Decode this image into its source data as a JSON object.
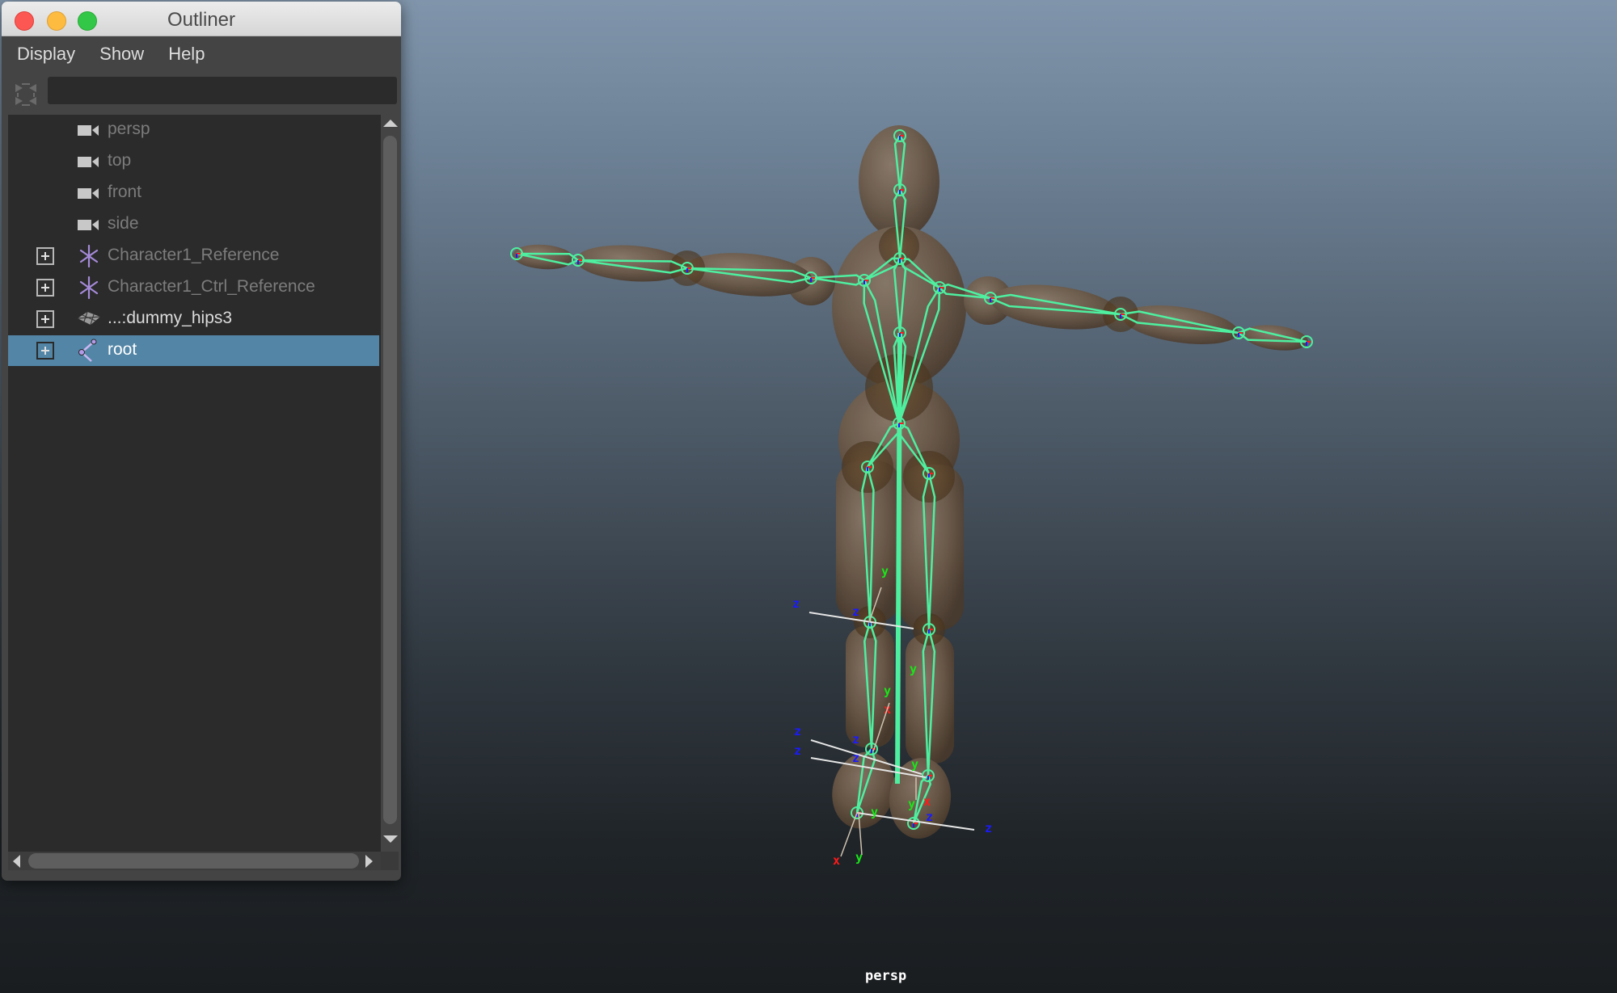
{
  "window": {
    "title": "Outliner",
    "menu": [
      "Display",
      "Show",
      "Help"
    ],
    "filter": {
      "value": "",
      "placeholder": ""
    }
  },
  "outliner": {
    "items": [
      {
        "label": "persp",
        "icon": "camera-icon",
        "expandable": false,
        "selected": false,
        "dimmed": true
      },
      {
        "label": "top",
        "icon": "camera-icon",
        "expandable": false,
        "selected": false,
        "dimmed": true
      },
      {
        "label": "front",
        "icon": "camera-icon",
        "expandable": false,
        "selected": false,
        "dimmed": true
      },
      {
        "label": "side",
        "icon": "camera-icon",
        "expandable": false,
        "selected": false,
        "dimmed": true
      },
      {
        "label": "Character1_Reference",
        "icon": "hik-character-icon",
        "expandable": true,
        "selected": false,
        "dimmed": true
      },
      {
        "label": "Character1_Ctrl_Reference",
        "icon": "hik-character-icon",
        "expandable": true,
        "selected": false,
        "dimmed": true
      },
      {
        "label": "...:dummy_hips3",
        "icon": "mesh-icon",
        "expandable": true,
        "selected": false,
        "dimmed": false
      },
      {
        "label": "root",
        "icon": "joint-icon",
        "expandable": true,
        "selected": true,
        "dimmed": false
      }
    ]
  },
  "viewport": {
    "camera_label": "persp",
    "axis_labels": {
      "x": "x",
      "y": "y",
      "z": "z"
    },
    "colors": {
      "skeleton": "#4ef0a0",
      "selection": "#5285a6",
      "axis_x": "#ff1a1a",
      "axis_y": "#19e619",
      "axis_z": "#1a1aff"
    }
  }
}
